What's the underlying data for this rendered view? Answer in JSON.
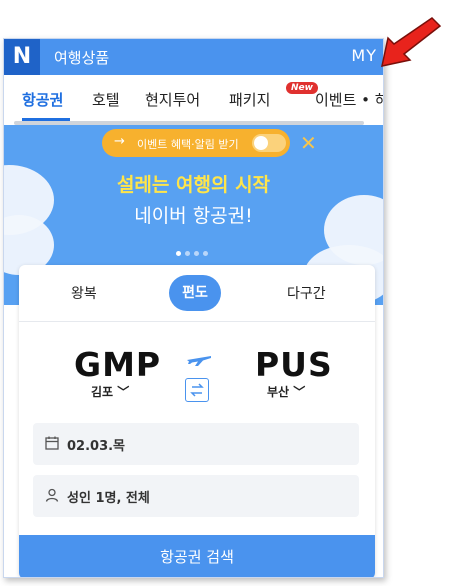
{
  "app": {
    "logo": "N",
    "title": "여행상품",
    "my_label": "MY"
  },
  "tabs": [
    {
      "label": "항공권",
      "active": true
    },
    {
      "label": "호텔"
    },
    {
      "label": "현지투어"
    },
    {
      "label": "패키지",
      "badge": "New"
    },
    {
      "label": "이벤트 • 혀"
    }
  ],
  "banner": {
    "notice_arrow": "→",
    "notice_text": "이벤트 혜택·알림 받기",
    "notice_toggle_on": false,
    "close_symbol": "✕",
    "headline": "설레는 여행의 시작",
    "subline": "네이버 항공권!",
    "slide_count": 4,
    "active_slide": 1
  },
  "booking": {
    "trip_types": [
      "왕복",
      "편도",
      "다구간"
    ],
    "selected_trip_type": "편도",
    "origin": {
      "code": "GMP",
      "city": "김포 ﹀"
    },
    "destination": {
      "code": "PUS",
      "city": "부산 ﹀"
    },
    "date_value": "02.03.목",
    "passenger_value": "성인 1명, 전체",
    "search_label": "항공권 검색"
  },
  "icons": {
    "plane": "plane-icon",
    "swap": "swap-icon",
    "calendar": "calendar-icon",
    "person": "person-icon",
    "annotation": "red-arrow-icon"
  },
  "colors": {
    "brand_blue": "#4a93ee",
    "logo_blue": "#1f63c8",
    "active_tab": "#1f6fe0",
    "headline_yellow": "#ffe54a",
    "notice_orange": "#f7b12e",
    "badge_red": "#e0312f",
    "annotation_red": "#e8231c"
  }
}
